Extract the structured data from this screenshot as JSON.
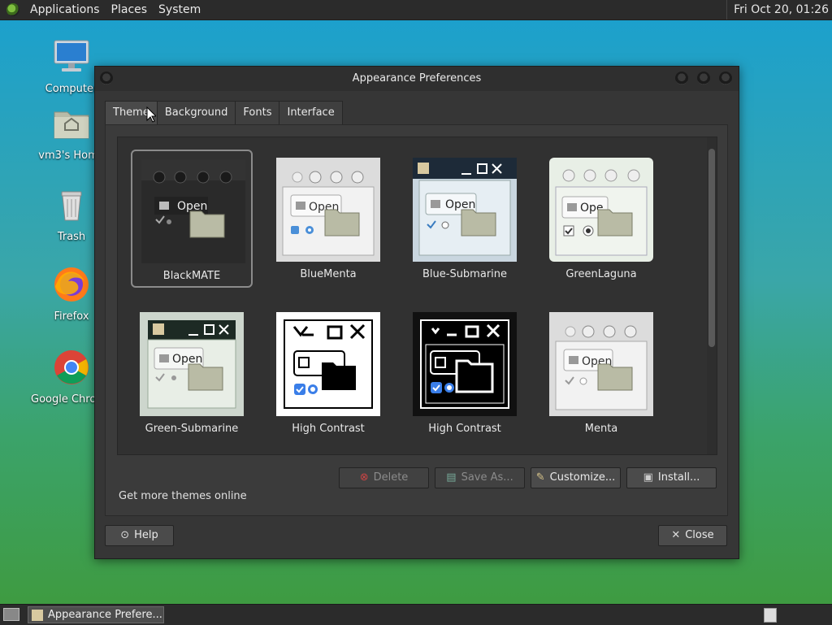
{
  "panel": {
    "menus": [
      "Applications",
      "Places",
      "System"
    ],
    "clock": "Fri Oct 20, 01:26"
  },
  "desktop": {
    "icons": [
      {
        "label": "Computer",
        "icon": "computer-icon"
      },
      {
        "label": "vm3's Home",
        "icon": "home-folder-icon"
      },
      {
        "label": "Trash",
        "icon": "trash-icon"
      },
      {
        "label": "Firefox",
        "icon": "firefox-icon"
      },
      {
        "label": "Google Chrome",
        "icon": "chrome-icon"
      }
    ]
  },
  "window": {
    "title": "Appearance Preferences",
    "tabs": [
      "Theme",
      "Background",
      "Fonts",
      "Interface"
    ],
    "active_tab": "Theme",
    "themes": [
      {
        "name": "BlackMATE",
        "selected": true
      },
      {
        "name": "BlueMenta",
        "selected": false
      },
      {
        "name": "Blue-Submarine",
        "selected": false
      },
      {
        "name": "GreenLaguna",
        "selected": false
      },
      {
        "name": "Green-Submarine",
        "selected": false
      },
      {
        "name": "High Contrast",
        "selected": false
      },
      {
        "name": "High Contrast",
        "selected": false
      },
      {
        "name": "Menta",
        "selected": false
      }
    ],
    "thumb_open_label": "Open",
    "buttons": {
      "delete": "Delete",
      "save_as": "Save As...",
      "customize": "Customize...",
      "install": "Install...",
      "help": "Help",
      "close": "Close"
    },
    "more_themes_link": "Get more themes online"
  },
  "taskbar": {
    "item_label": "Appearance Prefere..."
  },
  "colors": {
    "window_bg": "#363636",
    "panel_bg": "#2b2b2b"
  }
}
